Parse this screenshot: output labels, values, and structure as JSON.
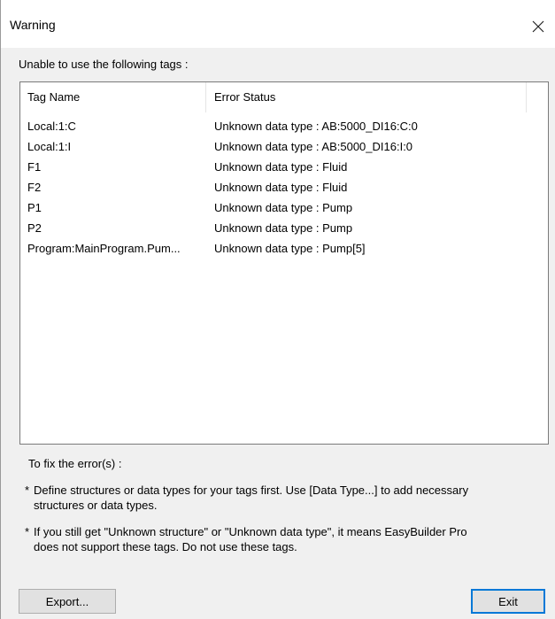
{
  "window": {
    "title": "Warning"
  },
  "intro": "Unable to use the following tags :",
  "table": {
    "headers": [
      "Tag Name",
      "Error Status"
    ],
    "rows": [
      {
        "tag": "Local:1:C",
        "status": "Unknown data type : AB:5000_DI16:C:0"
      },
      {
        "tag": "Local:1:I",
        "status": "Unknown data type : AB:5000_DI16:I:0"
      },
      {
        "tag": "F1",
        "status": "Unknown data type : Fluid"
      },
      {
        "tag": "F2",
        "status": "Unknown data type : Fluid"
      },
      {
        "tag": "P1",
        "status": "Unknown data type : Pump"
      },
      {
        "tag": "P2",
        "status": "Unknown data type : Pump"
      },
      {
        "tag": "Program:MainProgram.Pum...",
        "status": "Unknown data type : Pump[5]"
      }
    ]
  },
  "fix": {
    "title": "To fix the error(s) :",
    "notes": [
      {
        "bullet": "*",
        "line1": "Define structures or data types for your tags first. Use [Data Type...] to add necessary",
        "line2": "structures or data types."
      },
      {
        "bullet": "*",
        "line1": "If you still get \"Unknown structure\" or \"Unknown data type\", it means EasyBuilder Pro",
        "line2": "does not support these tags. Do not use these tags."
      }
    ]
  },
  "buttons": {
    "export": "Export...",
    "exit": "Exit"
  },
  "icons": {
    "close": "close-icon"
  }
}
